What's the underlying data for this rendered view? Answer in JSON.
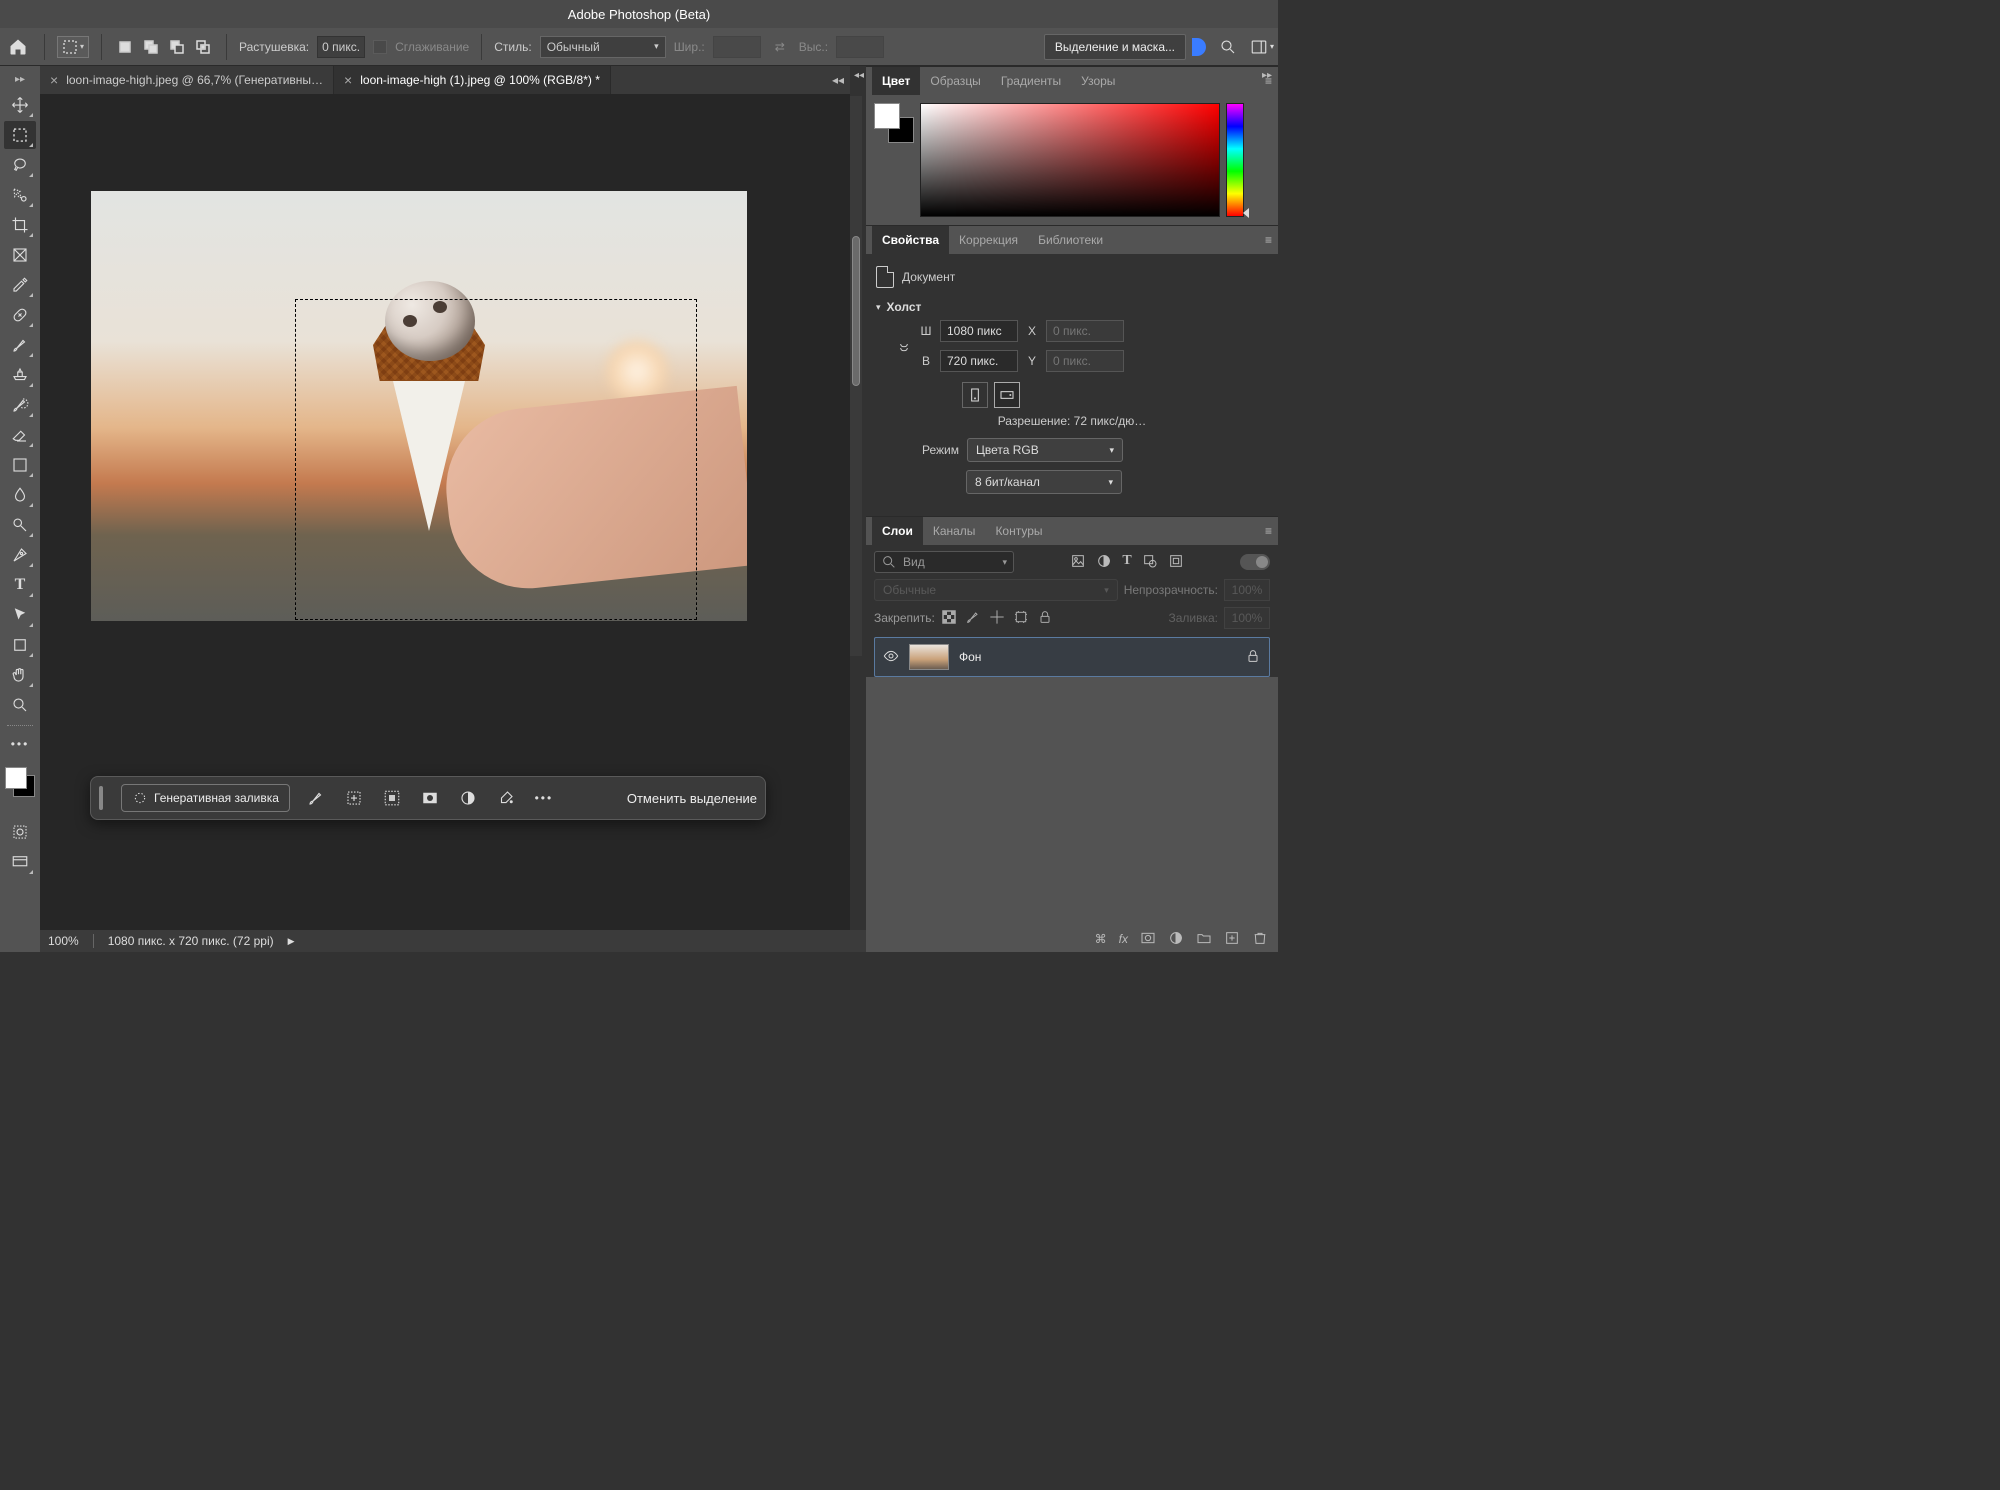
{
  "app_title": "Adobe Photoshop (Beta)",
  "options_bar": {
    "feather_label": "Растушевка:",
    "feather_value": "0 пикс.",
    "antialias_label": "Сглаживание",
    "style_label": "Стиль:",
    "style_value": "Обычный",
    "width_label": "Шир.:",
    "height_label": "Выс.:",
    "select_mask": "Выделение и маска..."
  },
  "tabs": [
    {
      "label": "loon-image-high.jpeg @ 66,7% (Генеративны…",
      "active": false
    },
    {
      "label": "loon-image-high (1).jpeg @ 100% (RGB/8*) *",
      "active": true
    }
  ],
  "ctx": {
    "gen_fill": "Генеративная заливка",
    "cancel": "Отменить выделение"
  },
  "status": {
    "zoom": "100%",
    "dims": "1080 пикс. x 720 пикс. (72 ppi)"
  },
  "panel_color": {
    "tabs": [
      "Цвет",
      "Образцы",
      "Градиенты",
      "Узоры"
    ]
  },
  "panel_props": {
    "tabs": [
      "Свойства",
      "Коррекция",
      "Библиотеки"
    ],
    "doc_label": "Документ",
    "canvas_label": "Холст",
    "w_label": "Ш",
    "w_value": "1080 пикс",
    "h_label": "В",
    "h_value": "720 пикс.",
    "x_label": "X",
    "x_value": "0 пикс.",
    "y_label": "Y",
    "y_value": "0 пикс.",
    "resolution": "Разрешение: 72 пикс/дю…",
    "mode_label": "Режим",
    "mode_value": "Цвета RGB",
    "depth_value": "8 бит/канал"
  },
  "panel_layers": {
    "tabs": [
      "Слои",
      "Каналы",
      "Контуры"
    ],
    "kind_placeholder": "Вид",
    "blend_value": "Обычные",
    "opacity_label": "Непрозрачность:",
    "opacity_value": "100%",
    "lock_label": "Закрепить:",
    "fill_label": "Заливка:",
    "fill_value": "100%",
    "layer_name": "Фон"
  }
}
